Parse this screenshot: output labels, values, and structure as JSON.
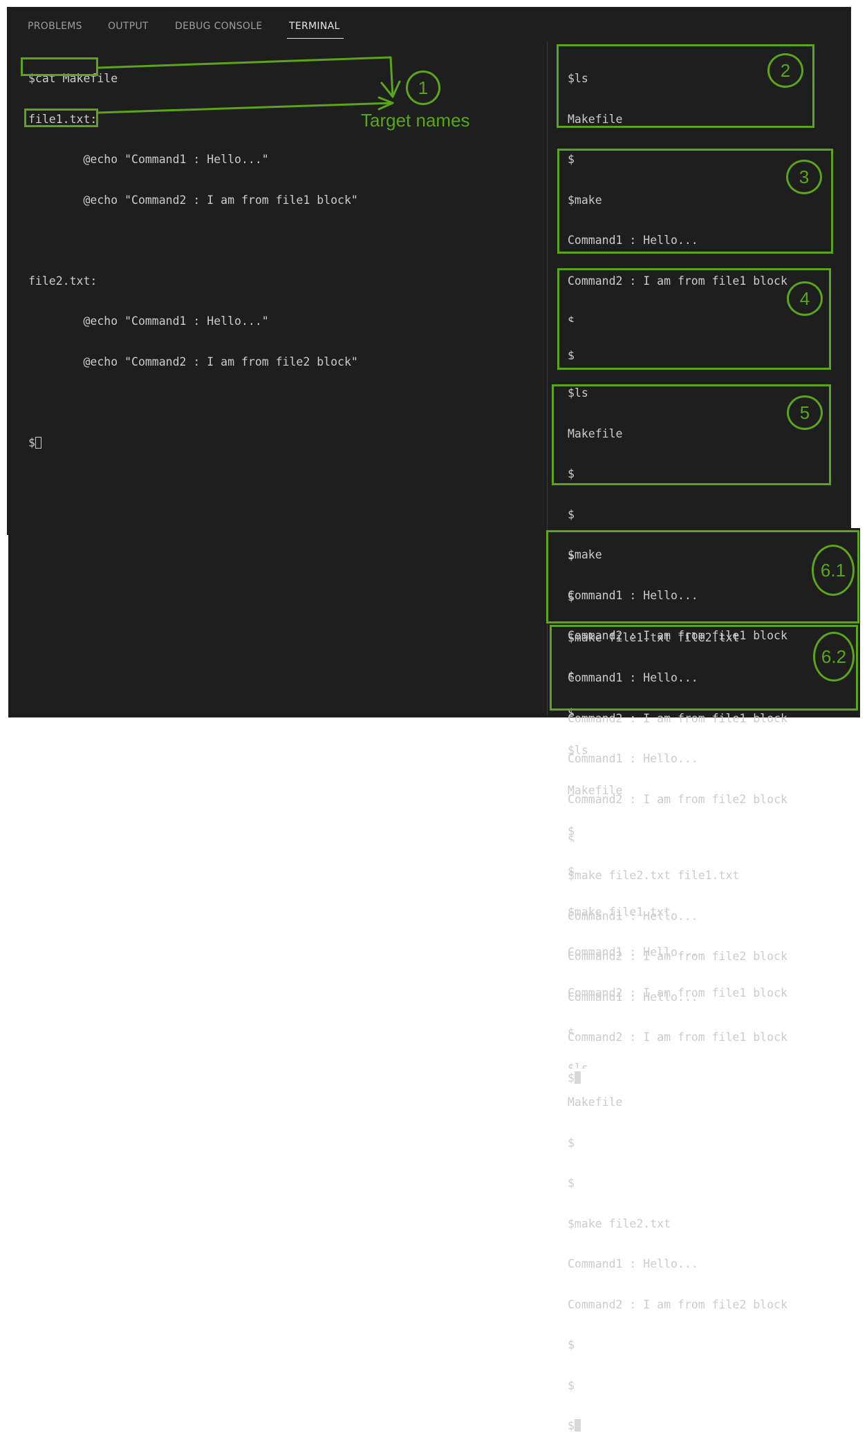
{
  "tabs": [
    "PROBLEMS",
    "OUTPUT",
    "DEBUG CONSOLE",
    "TERMINAL"
  ],
  "active_tab": "TERMINAL",
  "left_terminal": {
    "lines": [
      "$cat Makefile",
      "file1.txt:",
      "        @echo \"Command1 : Hello...\"",
      "        @echo \"Command2 : I am from file1 block\"",
      "",
      "file2.txt:",
      "        @echo \"Command1 : Hello...\"",
      "        @echo \"Command2 : I am from file2 block\"",
      "",
      "$"
    ]
  },
  "right_terminal": {
    "lines": [
      "$ls",
      "Makefile",
      "$",
      "$make",
      "Command1 : Hello...",
      "Command2 : I am from file1 block",
      "$",
      "$",
      "$ls",
      "Makefile",
      "$",
      "$",
      "$make",
      "Command1 : Hello...",
      "Command2 : I am from file1 block",
      "$",
      "$",
      "$ls",
      "Makefile",
      "$",
      "$",
      "$make file1.txt",
      "Command1 : Hello...",
      "Command2 : I am from file1 block",
      "$",
      "$ls",
      "Makefile",
      "$",
      "$",
      "$make file2.txt",
      "Command1 : Hello...",
      "Command2 : I am from file2 block",
      "$",
      "$",
      "$"
    ]
  },
  "bottom_terminal": {
    "lines": [
      "$",
      "$",
      "$make file1.txt file2.txt",
      "Command1 : Hello...",
      "Command2 : I am from file1 block",
      "Command1 : Hello...",
      "Command2 : I am from file2 block",
      "$",
      "$make file2.txt file1.txt",
      "Command1 : Hello...",
      "Command2 : I am from file2 block",
      "Command1 : Hello...",
      "Command2 : I am from file1 block",
      "$"
    ]
  },
  "annotations": {
    "target_names_label": "Target names",
    "markers": [
      "1",
      "2",
      "3",
      "4",
      "5",
      "6.1",
      "6.2"
    ],
    "color": "#5aa51a"
  }
}
